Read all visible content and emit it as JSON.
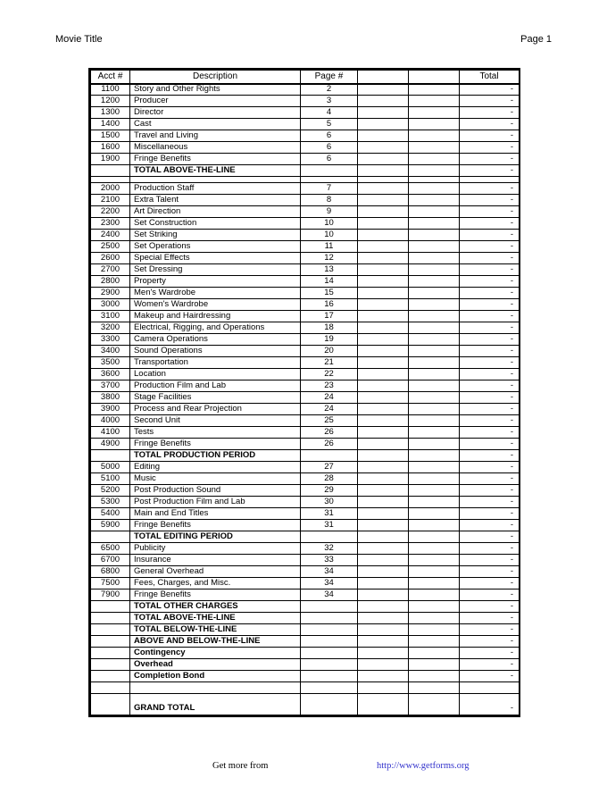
{
  "header": {
    "movie_title": "Movie Title",
    "page_label": "Page 1"
  },
  "table": {
    "columns": [
      "Acct #",
      "Description",
      "Page #",
      "",
      "",
      "Total"
    ],
    "dash": "-",
    "rows": [
      {
        "type": "item",
        "acct": "1100",
        "desc": "Story and Other Rights",
        "page": "2",
        "total": "-"
      },
      {
        "type": "item",
        "acct": "1200",
        "desc": "Producer",
        "page": "3",
        "total": "-"
      },
      {
        "type": "item",
        "acct": "1300",
        "desc": "Director",
        "page": "4",
        "total": "-"
      },
      {
        "type": "item",
        "acct": "1400",
        "desc": "Cast",
        "page": "5",
        "total": "-"
      },
      {
        "type": "item",
        "acct": "1500",
        "desc": "Travel and Living",
        "page": "6",
        "total": "-"
      },
      {
        "type": "item",
        "acct": "1600",
        "desc": "Miscellaneous",
        "page": "6",
        "total": "-"
      },
      {
        "type": "item",
        "acct": "1900",
        "desc": "Fringe Benefits",
        "page": "6",
        "total": "-"
      },
      {
        "type": "total",
        "acct": "",
        "desc": "TOTAL ABOVE-THE-LINE",
        "page": "",
        "total": "-"
      },
      {
        "type": "spacer",
        "acct": "",
        "desc": "",
        "page": "",
        "total": ""
      },
      {
        "type": "item",
        "acct": "2000",
        "desc": "Production Staff",
        "page": "7",
        "total": "-"
      },
      {
        "type": "item",
        "acct": "2100",
        "desc": "Extra Talent",
        "page": "8",
        "total": "-"
      },
      {
        "type": "item",
        "acct": "2200",
        "desc": "Art Direction",
        "page": "9",
        "total": "-"
      },
      {
        "type": "item",
        "acct": "2300",
        "desc": "Set Construction",
        "page": "10",
        "total": "-"
      },
      {
        "type": "item",
        "acct": "2400",
        "desc": "Set Striking",
        "page": "10",
        "total": "-"
      },
      {
        "type": "item",
        "acct": "2500",
        "desc": "Set Operations",
        "page": "11",
        "total": "-"
      },
      {
        "type": "item",
        "acct": "2600",
        "desc": "Special Effects",
        "page": "12",
        "total": "-"
      },
      {
        "type": "item",
        "acct": "2700",
        "desc": "Set Dressing",
        "page": "13",
        "total": "-"
      },
      {
        "type": "item",
        "acct": "2800",
        "desc": "Property",
        "page": "14",
        "total": "-"
      },
      {
        "type": "item",
        "acct": "2900",
        "desc": "Men's Wardrobe",
        "page": "15",
        "total": "-"
      },
      {
        "type": "item",
        "acct": "3000",
        "desc": "Women's Wardrobe",
        "page": "16",
        "total": "-"
      },
      {
        "type": "item",
        "acct": "3100",
        "desc": "Makeup and Hairdressing",
        "page": "17",
        "total": "-"
      },
      {
        "type": "item",
        "acct": "3200",
        "desc": "Electrical, Rigging, and Operations",
        "page": "18",
        "total": "-"
      },
      {
        "type": "item",
        "acct": "3300",
        "desc": "Camera Operations",
        "page": "19",
        "total": "-"
      },
      {
        "type": "item",
        "acct": "3400",
        "desc": "Sound Operations",
        "page": "20",
        "total": "-"
      },
      {
        "type": "item",
        "acct": "3500",
        "desc": "Transportation",
        "page": "21",
        "total": "-"
      },
      {
        "type": "item",
        "acct": "3600",
        "desc": "Location",
        "page": "22",
        "total": "-"
      },
      {
        "type": "item",
        "acct": "3700",
        "desc": "Production Film and Lab",
        "page": "23",
        "total": "-"
      },
      {
        "type": "item",
        "acct": "3800",
        "desc": "Stage Facilities",
        "page": "24",
        "total": "-"
      },
      {
        "type": "item",
        "acct": "3900",
        "desc": "Process and Rear Projection",
        "page": "24",
        "total": "-"
      },
      {
        "type": "item",
        "acct": "4000",
        "desc": "Second Unit",
        "page": "25",
        "total": "-"
      },
      {
        "type": "item",
        "acct": "4100",
        "desc": "Tests",
        "page": "26",
        "total": "-"
      },
      {
        "type": "item",
        "acct": "4900",
        "desc": "Fringe Benefits",
        "page": "26",
        "total": "-"
      },
      {
        "type": "total",
        "acct": "",
        "desc": "TOTAL PRODUCTION PERIOD",
        "page": "",
        "total": "-"
      },
      {
        "type": "item",
        "acct": "5000",
        "desc": "Editing",
        "page": "27",
        "total": "-"
      },
      {
        "type": "item",
        "acct": "5100",
        "desc": "Music",
        "page": "28",
        "total": "-"
      },
      {
        "type": "item",
        "acct": "5200",
        "desc": "Post Production Sound",
        "page": "29",
        "total": "-"
      },
      {
        "type": "item",
        "acct": "5300",
        "desc": "Post Production Film and Lab",
        "page": "30",
        "total": "-"
      },
      {
        "type": "item",
        "acct": "5400",
        "desc": "Main and End Titles",
        "page": "31",
        "total": "-"
      },
      {
        "type": "item",
        "acct": "5900",
        "desc": "Fringe Benefits",
        "page": "31",
        "total": "-"
      },
      {
        "type": "total",
        "acct": "",
        "desc": "TOTAL EDITING PERIOD",
        "page": "",
        "total": "-"
      },
      {
        "type": "item",
        "acct": "6500",
        "desc": "Publicity",
        "page": "32",
        "total": "-"
      },
      {
        "type": "item",
        "acct": "6700",
        "desc": "Insurance",
        "page": "33",
        "total": "-"
      },
      {
        "type": "item",
        "acct": "6800",
        "desc": "General Overhead",
        "page": "34",
        "total": "-"
      },
      {
        "type": "item",
        "acct": "7500",
        "desc": "Fees, Charges, and Misc.",
        "page": "34",
        "total": "-"
      },
      {
        "type": "item",
        "acct": "7900",
        "desc": "Fringe Benefits",
        "page": "34",
        "total": "-"
      },
      {
        "type": "total",
        "acct": "",
        "desc": "TOTAL OTHER CHARGES",
        "page": "",
        "total": "-"
      },
      {
        "type": "total",
        "acct": "",
        "desc": "TOTAL ABOVE-THE-LINE",
        "page": "",
        "total": "-"
      },
      {
        "type": "total",
        "acct": "",
        "desc": "TOTAL BELOW-THE-LINE",
        "page": "",
        "total": "-"
      },
      {
        "type": "total",
        "acct": "",
        "desc": "ABOVE AND BELOW-THE-LINE",
        "page": "",
        "total": "-"
      },
      {
        "type": "total",
        "acct": "",
        "desc": "Contingency",
        "page": "",
        "total": "-"
      },
      {
        "type": "total",
        "acct": "",
        "desc": "Overhead",
        "page": "",
        "total": "-"
      },
      {
        "type": "total",
        "acct": "",
        "desc": "Completion Bond",
        "page": "",
        "total": "-"
      },
      {
        "type": "gap",
        "acct": "",
        "desc": "",
        "page": "",
        "total": ""
      },
      {
        "type": "grand",
        "acct": "",
        "desc": "GRAND TOTAL",
        "page": "",
        "total": "-"
      }
    ]
  },
  "footer": {
    "label": "Get more from",
    "link_text": "http://www.getforms.org",
    "link_color": "#3333cc"
  }
}
